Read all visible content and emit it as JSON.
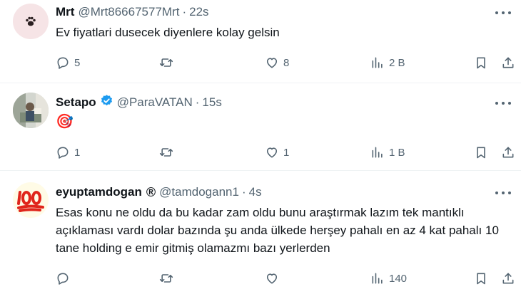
{
  "tweets": [
    {
      "display_name": "Mrt",
      "handle": "@Mrt86667577Mrt",
      "separator": "·",
      "time": "22s",
      "text": "Ev fiyatlari dusecek diyenlere kolay gelsin",
      "counts": {
        "replies": "5",
        "retweets": "",
        "likes": "8",
        "views": "2 B"
      }
    },
    {
      "display_name": "Setapo",
      "handle": "@ParaVATAN",
      "separator": "·",
      "time": "15s",
      "text": "🎯",
      "verified": true,
      "counts": {
        "replies": "1",
        "retweets": "",
        "likes": "1",
        "views": "1 B"
      }
    },
    {
      "display_name": "eyuptamdogan",
      "name_symbol": "®",
      "handle": "@tamdogann1",
      "separator": "·",
      "time": "4s",
      "text": "Esas konu ne oldu da bu kadar zam oldu bunu araştırmak lazım tek mantıklı açıklaması vardı dolar bazında şu anda ülkede herşey pahalı en az 4 kat pahalı 10 tane holding e emir gitmiş olamazmı bazı yerlerden",
      "counts": {
        "replies": "",
        "retweets": "",
        "likes": "",
        "views": "140"
      }
    }
  ],
  "colors": {
    "text": "#0f1419",
    "secondary": "#536471",
    "divider": "#eff3f4",
    "verified": "#1d9bf0"
  }
}
